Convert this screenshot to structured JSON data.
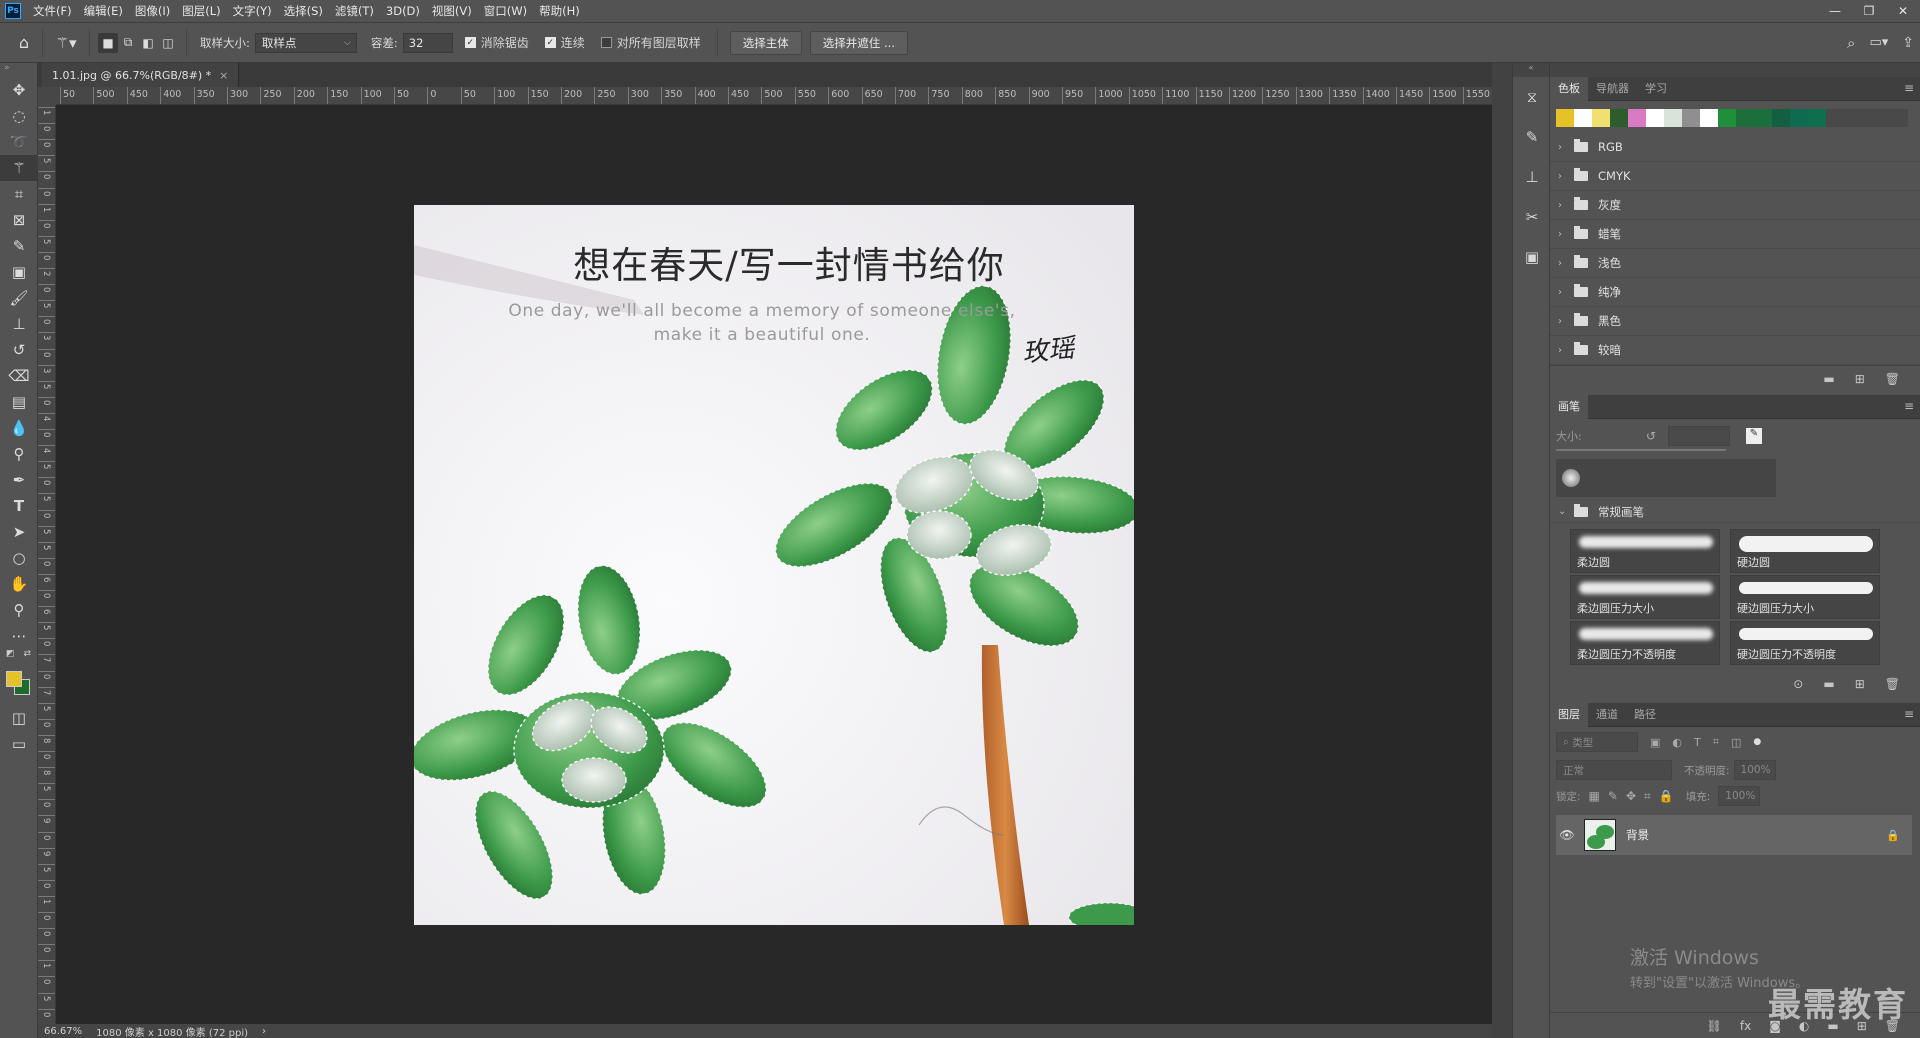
{
  "app": {
    "logo": "Ps",
    "menus": [
      "文件(F)",
      "编辑(E)",
      "图像(I)",
      "图层(L)",
      "文字(Y)",
      "选择(S)",
      "滤镜(T)",
      "3D(D)",
      "视图(V)",
      "窗口(W)",
      "帮助(H)"
    ],
    "window_controls": [
      "—",
      "❐",
      "✕"
    ]
  },
  "options": {
    "sample_size_label": "取样大小:",
    "sample_size_value": "取样点",
    "tolerance_label": "容差:",
    "tolerance_value": "32",
    "antialias_label": "消除锯齿",
    "antialias_checked": true,
    "contiguous_label": "连续",
    "contiguous_checked": true,
    "all_layers_label": "对所有图层取样",
    "all_layers_checked": false,
    "select_subject": "选择主体",
    "select_mask": "选择并遮住 ..."
  },
  "document": {
    "tab_title": "1.01.jpg @ 66.7%(RGB/8#) *",
    "zoom": "66.67%",
    "dimensions": "1080 像素 x 1080 像素 (72 ppi)",
    "status_arrow": "›"
  },
  "ruler": {
    "top": [
      "50",
      "500",
      "450",
      "400",
      "350",
      "300",
      "250",
      "200",
      "150",
      "100",
      "50",
      "0",
      "50",
      "100",
      "150",
      "200",
      "250",
      "300",
      "350",
      "400",
      "450",
      "500",
      "550",
      "600",
      "650",
      "700",
      "750",
      "800",
      "850",
      "900",
      "950",
      "1000",
      "1050",
      "1100",
      "1150",
      "1200",
      "1250",
      "1300",
      "1350",
      "1400",
      "1450",
      "1500",
      "1550",
      "16"
    ],
    "left": [
      "1",
      "0",
      "0",
      "5",
      "0",
      "0",
      "1",
      "0",
      "5",
      "0",
      "2",
      "0",
      "5",
      "0",
      "3",
      "0",
      "3",
      "5",
      "0",
      "4",
      "0",
      "4",
      "5",
      "0",
      "5",
      "0",
      "5",
      "5",
      "0",
      "6",
      "0",
      "6",
      "5",
      "0",
      "7",
      "0",
      "7",
      "5",
      "0",
      "8",
      "0",
      "8",
      "5",
      "0",
      "9",
      "0",
      "9",
      "5",
      "0",
      "1",
      "0",
      "0",
      "0",
      "1",
      "0",
      "5",
      "0"
    ]
  },
  "artwork": {
    "title": "想在春天/写一封情书给你",
    "subtitle_line1": "One day, we'll all become a memory of someone else's,",
    "subtitle_line2": "make it a beautiful one.",
    "signature": "玫瑶"
  },
  "colors": {
    "foreground": "#e6c229",
    "background": "#1f6b2c",
    "swatches": [
      "#e6c229",
      "#ffffff",
      "#f0e070",
      "#2d5d2d",
      "#d97ac5",
      "#ffffff",
      "#d8e4d8",
      "#8f8f8f",
      "#ffffff",
      "#1f8f3c",
      "#1d6e3a",
      "#1b6f3c",
      "#145f42",
      "#0f6b4f",
      "#0e6e4e"
    ]
  },
  "swatches_panel": {
    "tabs": [
      "色板",
      "导航器",
      "学习"
    ],
    "groups": [
      "RGB",
      "CMYK",
      "灰度",
      "蜡笔",
      "浅色",
      "纯净",
      "黑色",
      "较暗"
    ]
  },
  "brushes_panel": {
    "tab": "画笔",
    "size_label": "大小:",
    "group": "常规画笔",
    "brushes": [
      "柔边圆",
      "硬边圆",
      "柔边圆压力大小",
      "硬边圆压力大小",
      "柔边圆压力不透明度",
      "硬边圆压力不透明度"
    ]
  },
  "layers_panel": {
    "tabs": [
      "图层",
      "通道",
      "路径"
    ],
    "kind_label": "类型",
    "blend_mode": "正常",
    "opacity_label": "不透明度:",
    "opacity_value": "100%",
    "lock_label": "锁定:",
    "fill_label": "填充:",
    "fill_value": "100%",
    "layer_name": "背景"
  },
  "watermark": {
    "line1": "激活 Windows",
    "line2": "转到\"设置\"以激活 Windows。",
    "brand": "最需教育"
  }
}
